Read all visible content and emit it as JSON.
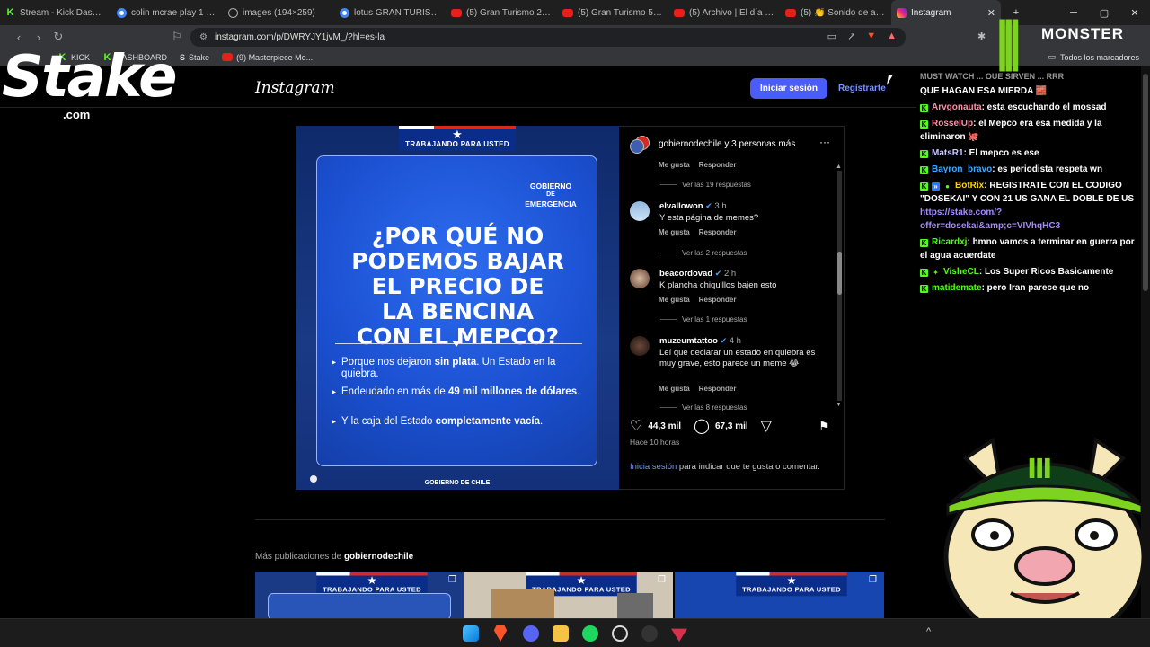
{
  "browser": {
    "tabs": [
      {
        "label": "Stream - Kick Dashbo",
        "icon": "kick-icon"
      },
      {
        "label": "colin mcrae play 1 - B",
        "icon": "google-icon"
      },
      {
        "label": "images (194×259)",
        "icon": "web-icon"
      },
      {
        "label": "lotus GRAN TURISMO",
        "icon": "google-icon"
      },
      {
        "label": "(5) Gran Turismo 2 —",
        "icon": "youtube-icon"
      },
      {
        "label": "(5) Gran Turismo 5 - F",
        "icon": "youtube-icon"
      },
      {
        "label": "(5) Archivo | El día en",
        "icon": "youtube-icon"
      },
      {
        "label": "(5) 👏 Sonido de apla",
        "icon": "youtube-icon"
      },
      {
        "label": "Instagram",
        "icon": "instagram-icon"
      }
    ],
    "new_tab": "+",
    "window_controls": [
      "─",
      "▢",
      "✕"
    ],
    "url": "instagram.com/p/DWRYJY1jvM_/?hl=es-la",
    "bookmarks": [
      {
        "label": "KICK",
        "icon": "kick-icon"
      },
      {
        "label": "DASHBOARD",
        "icon": "kick-icon"
      },
      {
        "label": "Stake",
        "icon": "stake-icon"
      },
      {
        "label": "(9) Masterpiece Mo...",
        "icon": "youtube-icon"
      }
    ],
    "all_bookmarks": "Todos los marcadores"
  },
  "overlay": {
    "stake_logo": "Stake",
    "stake_sub": ".com",
    "monster_logo": "MONSTER"
  },
  "instagram": {
    "logo": "Instagram",
    "login_button": "Iniciar sesión",
    "signup_link": "Regístrarte",
    "post": {
      "banner": "TRABAJANDO PARA USTED",
      "gov_label": [
        "GOBIERNO",
        "DE",
        "EMERGENCIA"
      ],
      "headline": [
        "¿POR QUÉ NO",
        "PODEMOS BAJAR",
        "EL PRECIO DE",
        "LA BENCINA",
        "CON EL MEPCO?"
      ],
      "bullets": [
        {
          "pre": "Porque nos dejaron ",
          "bold": "sin plata",
          "post": ". Un Estado en la quiebra."
        },
        {
          "pre": "Endeudado en más de ",
          "bold": "49 mil millones de dólares",
          "post": "."
        },
        {
          "pre": "Y la caja del Estado ",
          "bold": "completamente vacía",
          "post": "."
        }
      ],
      "footer": "GOBIERNO DE CHILE"
    },
    "panel": {
      "header_name": "gobiernodechile y 3 personas más",
      "more_icon": "···",
      "top_meta": {
        "like": "Me gusta",
        "reply": "Responder"
      },
      "top_replies": "Ver las 19 respuestas",
      "comments": [
        {
          "user": "elvallowon",
          "verified": "✔",
          "time": "3 h",
          "text": "Y esta página de memes?",
          "like": "Me gusta",
          "reply": "Responder",
          "replies": "Ver las 2 respuestas"
        },
        {
          "user": "beacordovad",
          "verified": "✔",
          "time": "2 h",
          "text": "K plancha chiquillos bajen esto",
          "like": "Me gusta",
          "reply": "Responder",
          "replies": "Ver las 1 respuestas"
        },
        {
          "user": "muzeumtattoo",
          "verified": "✔",
          "time": "4 h",
          "text": "Leí que declarar un estado en quiebra es muy grave, esto parece un meme 😂",
          "like": "Me gusta",
          "reply": "Responder",
          "replies": "Ver las 8 respuestas"
        }
      ],
      "likes": "44,3 mil",
      "comments_count": "67,3 mil",
      "time_ago": "Hace 10 horas",
      "login_prompt_link": "Inicia sesión",
      "login_prompt_rest": " para indicar que te gusta o comentar."
    },
    "more_posts_prefix": "Más publicaciones de ",
    "more_posts_user": "gobiernodechile"
  },
  "chat": {
    "messages": [
      {
        "user": "",
        "text": "QUE HAGAN ESA MIERDA 🧱",
        "color": "#ffffff"
      },
      {
        "user": "Arvgonauta",
        "text": ": esta escuchando el mossad",
        "color": "#ff8fa6"
      },
      {
        "user": "RosselUp",
        "text": ": el Mepco era esa medida y la eliminaron 🐙",
        "color": "#ff8fa6"
      },
      {
        "user": "MatsR1",
        "text": ": El mepco es ese",
        "color": "#c8c8ff"
      },
      {
        "user": "Bayron_bravo",
        "text": ": es periodista respeta wn",
        "color": "#3fa9ff"
      },
      {
        "user": "BotRix",
        "text": ": REGISTRATE CON EL CODIGO \"DOSEKAI\" Y CON 21 US GANA EL DOBLE DE US ",
        "link": "https://stake.com/?offer=dosekai&amp;c=VIVhqHC3",
        "color": "#ffd400"
      },
      {
        "user": "Ricardxj",
        "text": ": hmno vamos a terminar en guerra por el agua acuerdate",
        "color": "#53fc18"
      },
      {
        "user": "VisheCL",
        "text": ": Los Super Ricos Basicamente",
        "color": "#53fc18"
      },
      {
        "user": "matidemate",
        "text": ": pero Iran parece que no",
        "color": "#53fc18"
      }
    ]
  }
}
